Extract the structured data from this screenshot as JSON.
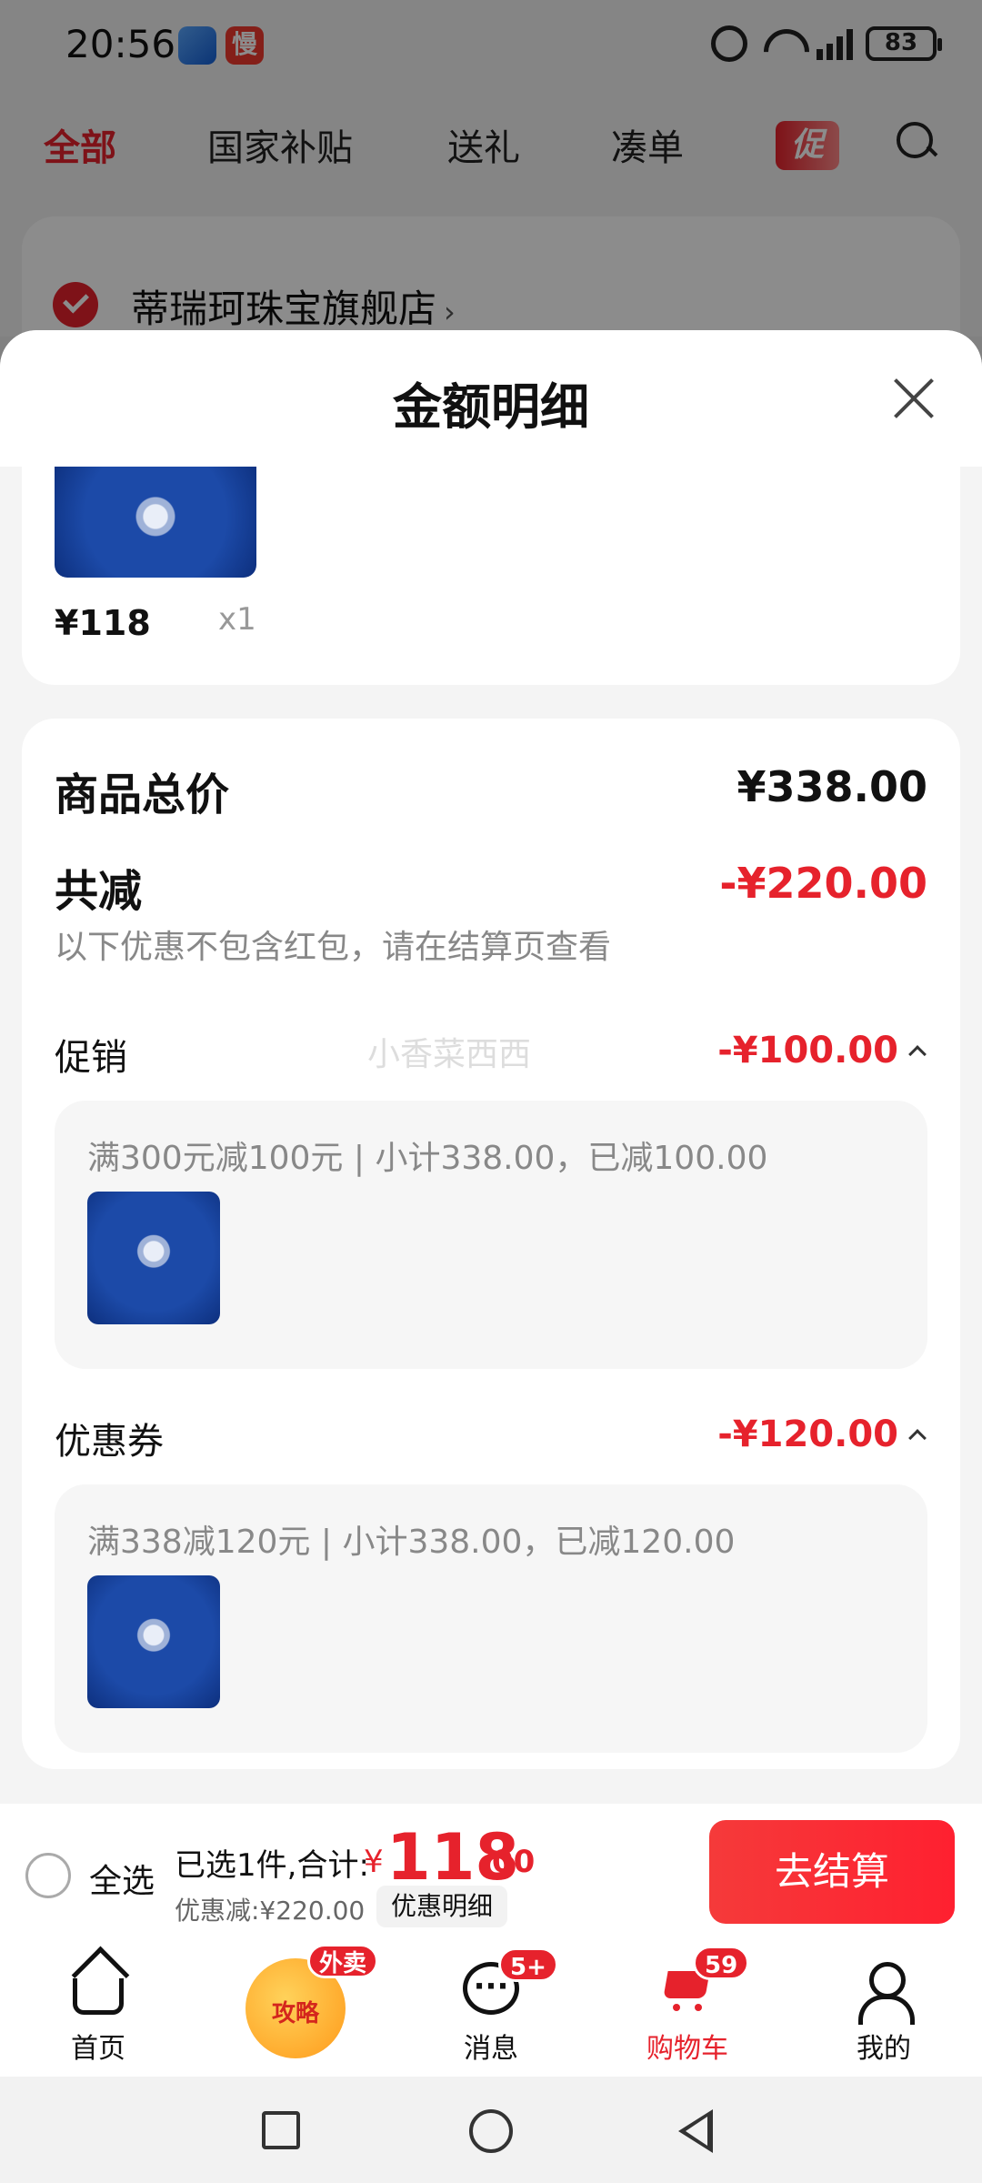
{
  "status_bar": {
    "time": "20:56",
    "app_icon_2_text": "慢",
    "battery": "83"
  },
  "top_tabs": [
    {
      "label": "全部",
      "active": true
    },
    {
      "label": "国家补贴",
      "active": false
    },
    {
      "label": "送礼",
      "active": false
    },
    {
      "label": "凑单",
      "active": false
    }
  ],
  "promo_badge": "促",
  "store": {
    "name": "蒂瑞珂珠宝旗舰店",
    "chevron": "›"
  },
  "sheet": {
    "title": "金额明细",
    "item": {
      "price": "¥118",
      "qty": "x1"
    },
    "summary": {
      "goods_total_label": "商品总价",
      "goods_total_value": "¥338.00",
      "reduce_label": "共减",
      "reduce_value": "-¥220.00",
      "note": "以下优惠不包含红包，请在结算页查看",
      "watermark": "小香菜西西",
      "promotion": {
        "label": "促销",
        "value": "-¥100.00",
        "detail": "满300元减100元 | 小计338.00，已减100.00"
      },
      "coupon": {
        "label": "优惠券",
        "value": "-¥120.00",
        "detail": "满338减120元 | 小计338.00，已减120.00"
      }
    }
  },
  "checkout": {
    "select_all": "全选",
    "selected_summary": "已选1件,合计:",
    "total_currency": "¥",
    "total_integer": "118",
    "total_decimal": ".00",
    "discount_text": "优惠减:¥220.00",
    "discount_detail_button": "优惠明细",
    "checkout_button": "去结算"
  },
  "bottom_nav": {
    "home": "首页",
    "strategy": "攻略",
    "strategy_badge": "外卖",
    "messages": "消息",
    "messages_badge": "5+",
    "cart": "购物车",
    "cart_badge": "59",
    "me": "我的"
  },
  "colors": {
    "accent": "#e6222c",
    "dim_overlay": "rgba(0,0,0,0.45)"
  }
}
